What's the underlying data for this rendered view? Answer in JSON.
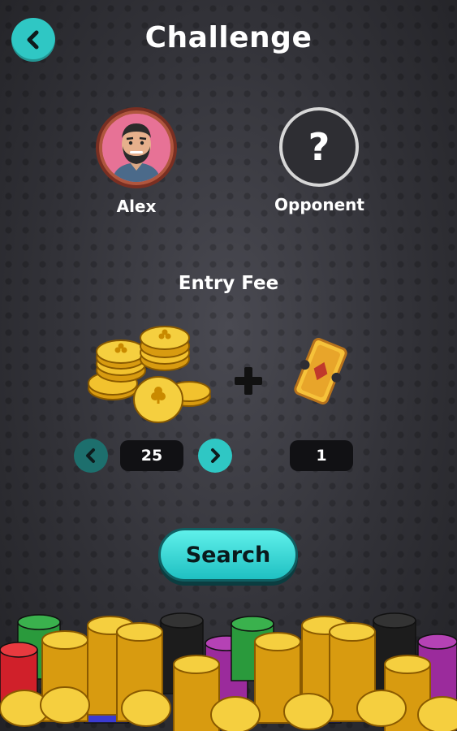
{
  "header": {
    "title": "Challenge",
    "back_icon": "chevron-left-icon"
  },
  "players": {
    "me": {
      "name": "Alex"
    },
    "opponent": {
      "name": "Opponent",
      "placeholder_symbol": "?"
    }
  },
  "entry_fee": {
    "title": "Entry Fee",
    "coins": "25",
    "tickets": "1"
  },
  "actions": {
    "search_label": "Search"
  },
  "colors": {
    "accent": "#2fc7c4",
    "accent_dark": "#1d6f6d",
    "gold": "#f2c22e"
  }
}
